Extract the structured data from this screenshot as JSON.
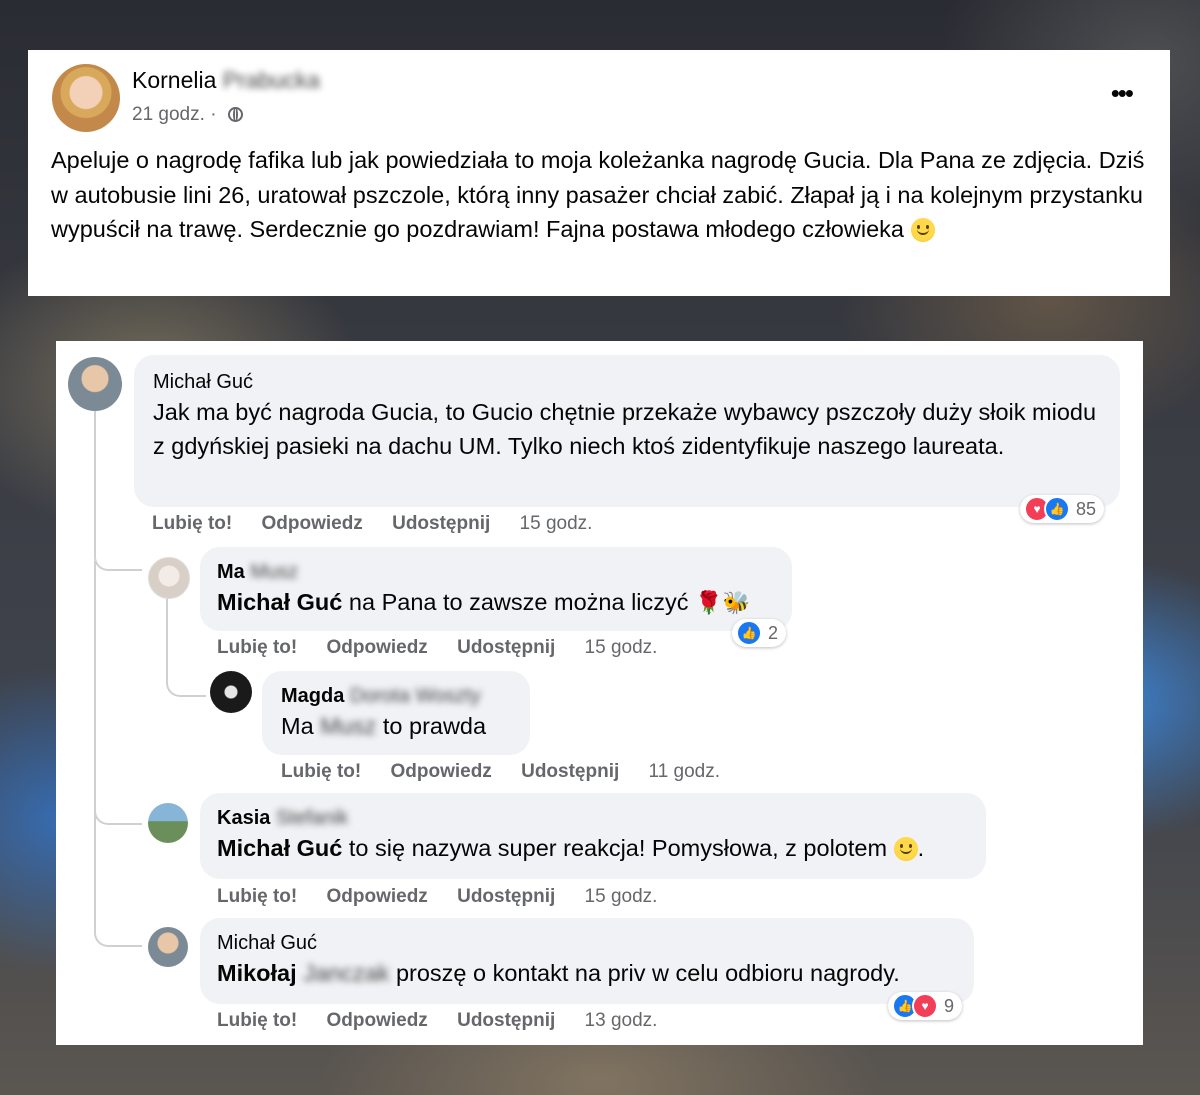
{
  "post": {
    "author_first": "Kornelia",
    "author_last_blurred": "Prabucka",
    "time": "21 godz.",
    "separator": "·",
    "privacy_icon": "globe-icon",
    "more_label": "•••",
    "text": "Apeluje o nagrodę fafika lub jak powiedziała to moja koleżanka nagrodę Gucia. Dla Pana ze zdjęcia. Dziś w autobusie lini 26, uratował pszczole, którą inny pasażer chciał zabić. Złapał ją i na kolejnym przystanku wypuścił na trawę. Serdecznie go pozdrawiam! Fajna postawa młodego człowieka"
  },
  "actions": {
    "like": "Lubię to!",
    "reply": "Odpowiedz",
    "share": "Udostępnij"
  },
  "comments": [
    {
      "author": "Michał Guć",
      "text": "Jak ma być nagroda Gucia, to Gucio chętnie przekaże wybawcy pszczoły duży słoik miodu z gdyńskiej pasieki na dachu UM. Tylko niech ktoś zidentyfikuje naszego laureata.",
      "time": "15 godz.",
      "reactions": "85"
    },
    {
      "author_first": "Ma",
      "author_last_blurred": "Musz",
      "mention": "Michał Guć",
      "text": " na Pana to zawsze można liczyć ",
      "emojis": "🌹🐝",
      "time": "15 godz.",
      "reactions": "2"
    },
    {
      "author_first": "Magda",
      "author_last_blurred": "Dorota Woszty",
      "mention_first": "Ma",
      "mention_last_blurred": "Musz",
      "text": " to prawda",
      "time": "11 godz."
    },
    {
      "author_first": "Kasia",
      "author_last_blurred": "Stefanik",
      "mention": "Michał Guć",
      "text": " to się nazywa super reakcja! Pomysłowa, z polotem ",
      "text_end": ".",
      "time": "15 godz."
    },
    {
      "author": "Michał Guć",
      "mention_first": "Mikołaj",
      "mention_last_blurred": "Janczak",
      "text": " proszę o kontakt na priv w celu odbioru nagrody.",
      "time": "13 godz.",
      "reactions": "9"
    }
  ],
  "colors": {
    "meta_gray": "#65676b",
    "bubble_bg": "#f0f2f5",
    "like_blue": "#1877f2",
    "love_red": "#f33e58"
  }
}
